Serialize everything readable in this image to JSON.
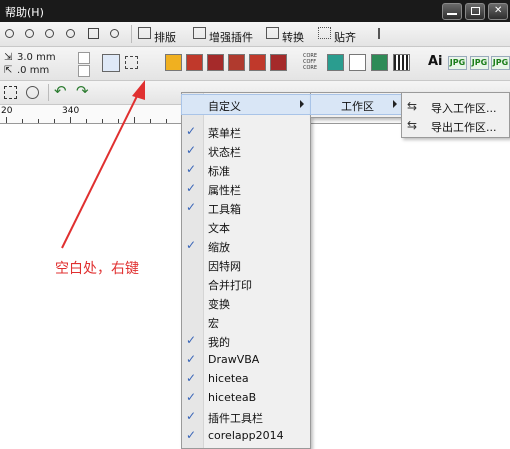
{
  "window": {
    "title": "帮助(H)"
  },
  "toolbar": {
    "layout_label": "排版",
    "enhance_label": "增强插件",
    "convert_label": "转换",
    "align_label": "贴齐",
    "ai_label": "Ai",
    "jpg_label": "JPG",
    "corel_badge": "CORE COFF CORE"
  },
  "props": {
    "x_value": "3.0 mm",
    "y_value": ".0 mm"
  },
  "ruler": {
    "ticks": [
      "20",
      "340"
    ]
  },
  "annotation": {
    "text": "空白处，右键",
    "color": "#e03030"
  },
  "context_menu": {
    "items": [
      {
        "label": "自定义",
        "checked": false,
        "submenu": true,
        "highlighted": true
      },
      {
        "label": "菜单栏",
        "checked": true
      },
      {
        "label": "状态栏",
        "checked": true
      },
      {
        "label": "标准",
        "checked": true
      },
      {
        "label": "属性栏",
        "checked": true
      },
      {
        "label": "工具箱",
        "checked": true
      },
      {
        "label": "文本",
        "checked": false
      },
      {
        "label": "缩放",
        "checked": true
      },
      {
        "label": "因特网",
        "checked": false
      },
      {
        "label": "合并打印",
        "checked": false
      },
      {
        "label": "变换",
        "checked": false
      },
      {
        "label": "宏",
        "checked": false
      },
      {
        "label": "我的",
        "checked": true
      },
      {
        "label": "DrawVBA",
        "checked": true
      },
      {
        "label": "hicetea",
        "checked": true
      },
      {
        "label": "hiceteaB",
        "checked": true
      },
      {
        "label": "插件工具栏",
        "checked": true
      },
      {
        "label": "corelapp2014",
        "checked": true
      }
    ]
  },
  "submenu1": {
    "label": "工作区"
  },
  "submenu2": {
    "items": [
      {
        "label": "导入工作区..."
      },
      {
        "label": "导出工作区..."
      }
    ]
  },
  "colors": {
    "arrow": "#e03030",
    "check": "#3a66b8",
    "highlight": "#d9e6f6"
  }
}
